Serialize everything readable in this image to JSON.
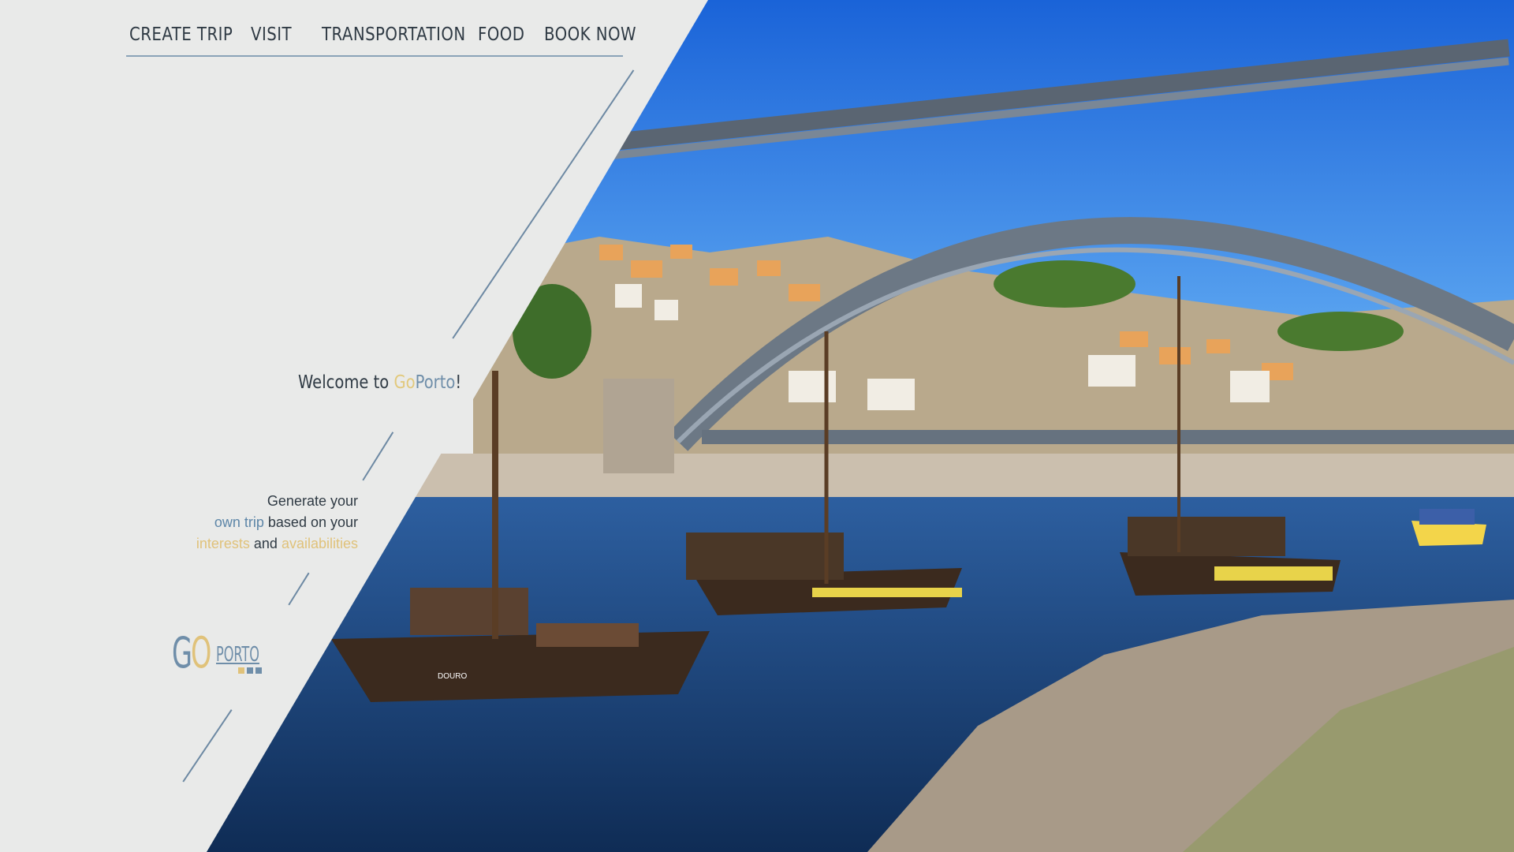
{
  "nav": {
    "items": [
      {
        "label": "CREATE TRIP"
      },
      {
        "label": "VISIT"
      },
      {
        "label": "TRANSPORTATION"
      },
      {
        "label": "FOOD"
      },
      {
        "label": "BOOK NOW"
      }
    ]
  },
  "welcome": {
    "prefix": "Welcome to ",
    "brand_go": "Go",
    "brand_porto": "Porto",
    "suffix": "!"
  },
  "tagline": {
    "line1": "Generate your",
    "line2_highlight": "own trip",
    "line2_rest": " based on your",
    "line3_highlight1": "interests",
    "line3_and": " and ",
    "line3_highlight2": "availabilities"
  },
  "logo": {
    "letter_g": "G",
    "letter_o": "O",
    "word": "PORTO"
  },
  "hero": {
    "boat_name": "DOURO"
  },
  "colors": {
    "panel_bg": "#e9eae9",
    "accent_blue": "#6f8ea9",
    "accent_gold": "#e0c27a",
    "text_dark": "#2f3a44",
    "sky": "#1f6fe0",
    "river": "#1d4f86"
  },
  "icons": [
    "goporto-logo"
  ]
}
